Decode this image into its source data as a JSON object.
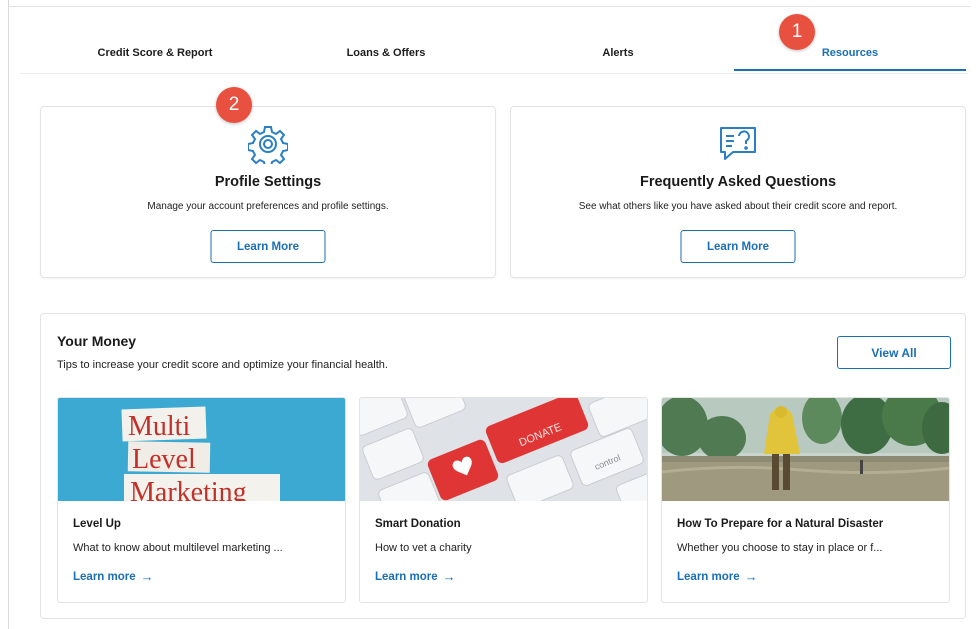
{
  "tabs": [
    {
      "label": "Credit Score & Report"
    },
    {
      "label": "Loans & Offers"
    },
    {
      "label": "Alerts"
    },
    {
      "label": "Resources"
    }
  ],
  "active_tab": "Resources",
  "badges": {
    "one": "1",
    "two": "2"
  },
  "cards": [
    {
      "icon": "gear-icon",
      "title": "Profile Settings",
      "description": "Manage your account preferences and profile settings.",
      "button": "Learn More"
    },
    {
      "icon": "faq-chat-icon",
      "title": "Frequently Asked Questions",
      "description": "See what others like you have asked about their credit score and report.",
      "button": "Learn More"
    }
  ],
  "money": {
    "title": "Your Money",
    "subtitle": "Tips to increase your credit score and optimize your financial health.",
    "view_all": "View All",
    "articles": [
      {
        "image_text": [
          "Multi",
          "Level",
          "Marketing"
        ],
        "title": "Level Up",
        "description": "What to know about multilevel marketing ...",
        "link": "Learn more"
      },
      {
        "image_text": [
          "DONATE",
          "control"
        ],
        "title": "Smart Donation",
        "description": "How to vet a charity",
        "link": "Learn more"
      },
      {
        "title": "How To Prepare for a Natural Disaster",
        "description": "Whether you choose to stay in place or f...",
        "link": "Learn more"
      }
    ]
  },
  "colors": {
    "accent": "#1a6fb5",
    "badge": "#e8503f",
    "icon": "#2a7fc4"
  }
}
